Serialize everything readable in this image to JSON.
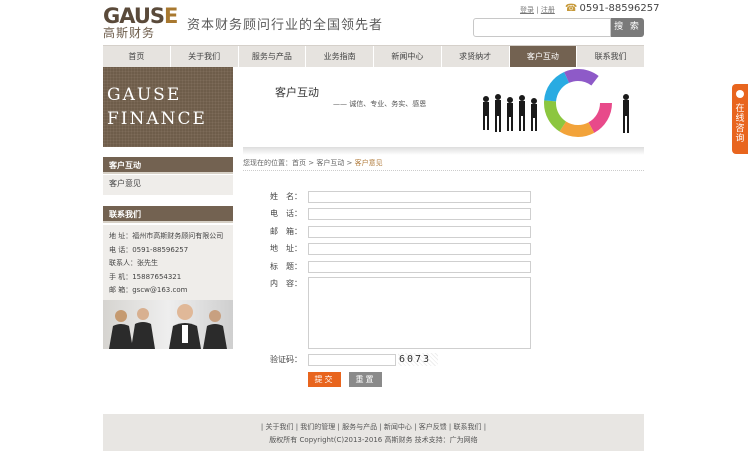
{
  "header": {
    "logo_en_a": "GAUS",
    "logo_en_b": "E",
    "logo_cn": "高斯财务",
    "slogan": "资本财务顾问行业的全国领先者",
    "login": "登录",
    "register": "注册",
    "separator": "|",
    "phone": "0591-88596257",
    "search_button": "搜 索"
  },
  "nav": {
    "items": [
      "首页",
      "关于我们",
      "服务与产品",
      "业务指南",
      "新闻中心",
      "求贤纳才",
      "客户互动",
      "联系我们"
    ],
    "active_index": 6
  },
  "banner": {
    "left_line1": "GAUSE",
    "left_line2": "FINANCE",
    "title": "客户互动",
    "subtitle": "—— 诚信、专业、务实、感恩"
  },
  "sidebar": {
    "section_title": "客户互动",
    "item": "客户意见",
    "contact_title": "联系我们",
    "contact": {
      "address": "地 址：福州市高斯财务顾问有限公司",
      "tel": "电 话：0591-88596257",
      "person": "联系人：张先生",
      "mobile": "手 机：15887654321",
      "email": "邮 箱：gscw@163.com"
    }
  },
  "breadcrumb": {
    "prefix": "您现在的位置：",
    "home": "首页",
    "sep": " > ",
    "section": "客户互动",
    "current": "客户意见"
  },
  "form": {
    "labels": {
      "name": "姓　名：",
      "phone": "电　话：",
      "email": "邮　箱：",
      "address": "地　址：",
      "subject": "标　题：",
      "content": "内　容：",
      "captcha": "验证码："
    },
    "captcha_text": "6073",
    "submit": "提交",
    "reset": "重置"
  },
  "footer": {
    "links": "| 关于我们 | 我们的管理 | 服务与产品 | 新闻中心 | 客户反馈 | 联系我们 |",
    "copyright": "版权所有 Copyright(C)2013-2016 高斯财务 技术支持：广为网络"
  },
  "float_chat": {
    "text": "在线咨询"
  },
  "colors": {
    "brown": "#736251",
    "orange": "#e8651e",
    "gray": "#8a8a8a"
  }
}
